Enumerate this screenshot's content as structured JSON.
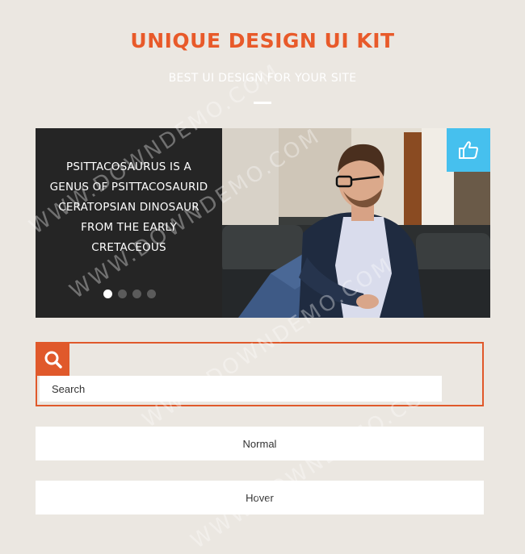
{
  "header": {
    "title": "UNIQUE DESIGN UI KIT",
    "subtitle": "BEST UI DESIGN FOR YOUR SITE"
  },
  "slider": {
    "caption": "PSITTACOSAURUS IS A GENUS OF PSITTACOSAURID CERATOPSIAN DINOSAUR FROM THE EARLY CRETACEOUS",
    "dot_count": 4,
    "active_dot": 1,
    "like_icon": "thumbs-up-icon",
    "like_color": "#46c0ee"
  },
  "search": {
    "placeholder": "Search",
    "icon": "search-icon",
    "accent_color": "#e0592b"
  },
  "buttons": {
    "normal_label": "Normal",
    "hover_label": "Hover"
  },
  "watermark": {
    "text": "WWW.DOWNDEMO.COM"
  },
  "colors": {
    "accent": "#e85a2a",
    "background": "#ebe7e1",
    "panel": "#252525"
  }
}
